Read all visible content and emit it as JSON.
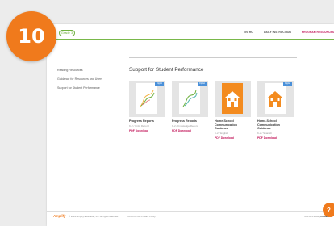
{
  "step_badge": "10",
  "header": {
    "grade": "Grade 3",
    "nav": [
      "INTRO",
      "DAILY INSTRUCTION",
      "PROGRAM RESOURCES"
    ]
  },
  "sidebar": {
    "items": [
      "Reading Resources",
      "Guidance for Resources and Users",
      "Support for Student Performance"
    ]
  },
  "main": {
    "heading": "Support for Student Performance",
    "cards": [
      {
        "title": "Progress Reports",
        "subtitle": "K-2 / Units Record",
        "link": "PDF Download",
        "tag": "Digital"
      },
      {
        "title": "Progress Reports",
        "subtitle": "K-2 / Knowledge Record",
        "link": "PDF Download",
        "tag": "Digital"
      },
      {
        "title": "Home-School Communication Guidance",
        "subtitle": "K-2 / English",
        "link": "PDF Download",
        "tag": ""
      },
      {
        "title": "Home-School Communication Guidance",
        "subtitle": "K-2 / Spanish",
        "link": "PDF Download",
        "tag": "Digital"
      }
    ]
  },
  "footer": {
    "logo": "Amplify",
    "copyright": "© 2024 Amplify Education, Inc. All rights reserved.",
    "links": "Terms of Use   Privacy Policy",
    "phone": "800-823-1969",
    "contact": "Contact Us"
  },
  "colors": {
    "accent": "#c2185b",
    "green": "#79b84a",
    "orange": "#f07a1c"
  }
}
